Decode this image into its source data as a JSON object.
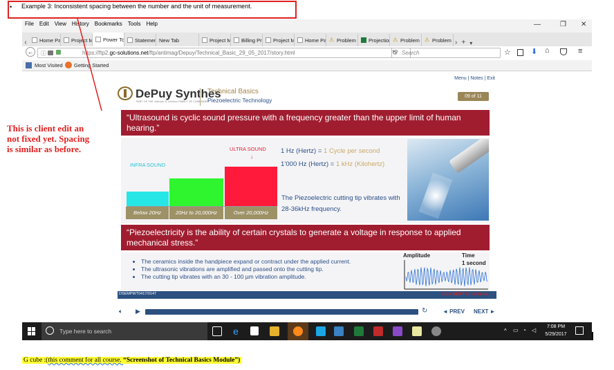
{
  "annotation": {
    "bullet": "•",
    "top_note": "Example 3: Inconsistent spacing between the number and the unit of measurement.",
    "side_note": "This is client edit an not fixed yet. Spacing is similar as before.",
    "bottom_note_prefix": "G cube :(",
    "bottom_note_mid": "this comment for all course. ",
    "bottom_note_bold": "“Screenshot of Technical Basics Module”)"
  },
  "browser": {
    "menu": [
      "File",
      "Edit",
      "View",
      "History",
      "Bookmarks",
      "Tools",
      "Help"
    ],
    "tabs": [
      {
        "label": "Home Pag",
        "icon": "page"
      },
      {
        "label": "Project Ma",
        "icon": "page"
      },
      {
        "label": "Power Tool",
        "icon": "page",
        "active": true
      },
      {
        "label": "Statement",
        "icon": "page"
      },
      {
        "label": "New Tab",
        "icon": "none"
      },
      {
        "label": "Project Ma",
        "icon": "page"
      },
      {
        "label": "Billing Proj",
        "icon": "page"
      },
      {
        "label": "Project Ma",
        "icon": "page"
      },
      {
        "label": "Home Pag",
        "icon": "page"
      },
      {
        "label": "Problem lo",
        "icon": "warn"
      },
      {
        "label": "Projection",
        "icon": "xls"
      },
      {
        "label": "Problem lo",
        "icon": "warn"
      },
      {
        "label": "Problem lo",
        "icon": "warn"
      }
    ],
    "url_prefix": "https://ftp2.",
    "url_domain": "gc-solutions.net",
    "url_path": "/ftp/antimag/Depuy/Technical_Basic_29_05_2017/story.html",
    "search_placeholder": "Search",
    "bookmarks": [
      "Most Visited",
      "Getting Started"
    ]
  },
  "module": {
    "top_links": "Menu | Notes | Exit",
    "brand": "DePuy Synthes",
    "brand_sub": "PART OF THE Johnson & Johnson FAMILY OF COMPANIES",
    "title": "Technical Basics",
    "subtitle": "Piezoelectric Technology",
    "page": "09 of 11",
    "banner1": "“Ultrasound is cyclic sound pressure with a frequency greater than the upper limit of human hearing.”",
    "infra_label": "INFRA SOUND",
    "ultra_label": "ULTRA SOUND",
    "bar_labels": [
      "Below 20Hz",
      "20Hz to 20,000Hz",
      "Over 20,000Hz"
    ],
    "def1_a": "1 Hz (Hertz) = ",
    "def1_b": "1 Cycle per second",
    "def2_a": "1’000 Hz (Hertz) = ",
    "def2_b": "1 kHz (Kilohertz)",
    "tip_text": "The Piezoelectric cutting tip vibrates with 28-36kHz frequency.",
    "banner2": "“Piezoelectricity is the ability of certain crystals to generate a voltage in response to applied mechanical stress.”",
    "bullets": [
      "The ceramics inside the handpiece expand or contract under the applied current.",
      "The ultrasonic vibrations are amplified and passed onto the cutting tip.",
      "The cutting tip vibrates with an 30 - 100 µm vibration amplitude."
    ],
    "wave_amplitude": "Amplitude",
    "wave_time": "Time",
    "wave_time2": "1 second",
    "doc_code": "DSEMPWT0417/0147",
    "click_prefix": "Click ",
    "click_next": "NEXT",
    "click_suffix": " to continue.",
    "prev": "◄ PREV",
    "next": "NEXT ►"
  },
  "taskbar": {
    "search": "Type here to search",
    "time": "7:08 PM",
    "date": "5/29/2017"
  },
  "colors": {
    "banner": "#a01d30",
    "infra": "#27e6e6",
    "audible": "#2ef52e",
    "ultra": "#ff1a3c",
    "accent_text": "#c9a865"
  }
}
